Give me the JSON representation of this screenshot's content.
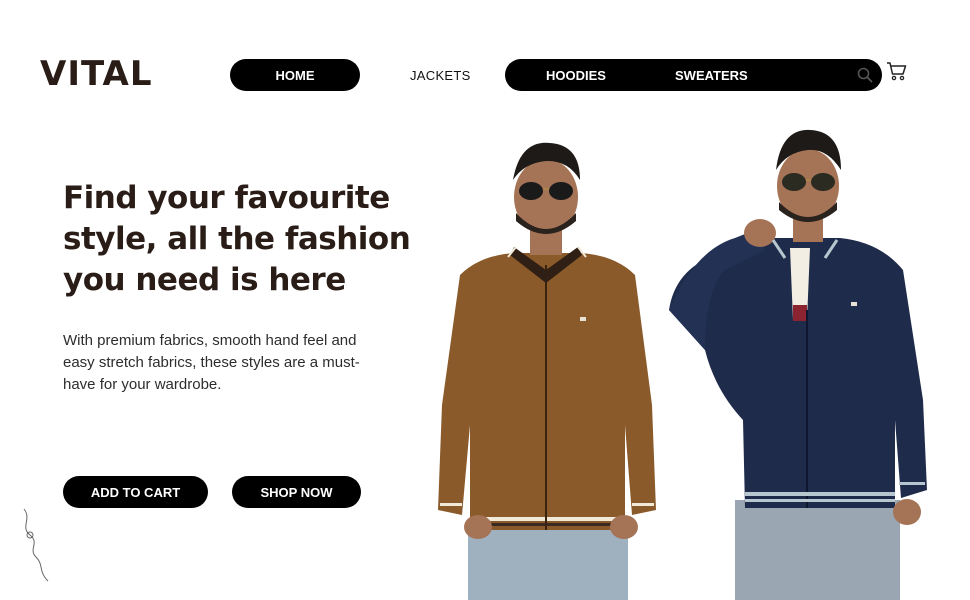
{
  "brand": {
    "logo": "VITAL"
  },
  "nav": {
    "home": "HOME",
    "jackets": "JACKETS",
    "hoodies": "HOODIES",
    "sweaters": "SWEATERS",
    "search_icon": "search-icon",
    "cart_icon": "cart-icon"
  },
  "hero": {
    "headline": "Find your favourite style, all the fashion you need is here",
    "description": "With premium fabrics, smooth hand feel and easy stretch fabrics, these styles are a must-have for your wardrobe.",
    "add_to_cart": "ADD TO CART",
    "shop_now": "SHOP NOW"
  },
  "colors": {
    "accent": "#000000",
    "text_dark": "#2a1d17",
    "brown_jacket": "#8a5a2b",
    "navy_jacket": "#1f2b4a"
  }
}
